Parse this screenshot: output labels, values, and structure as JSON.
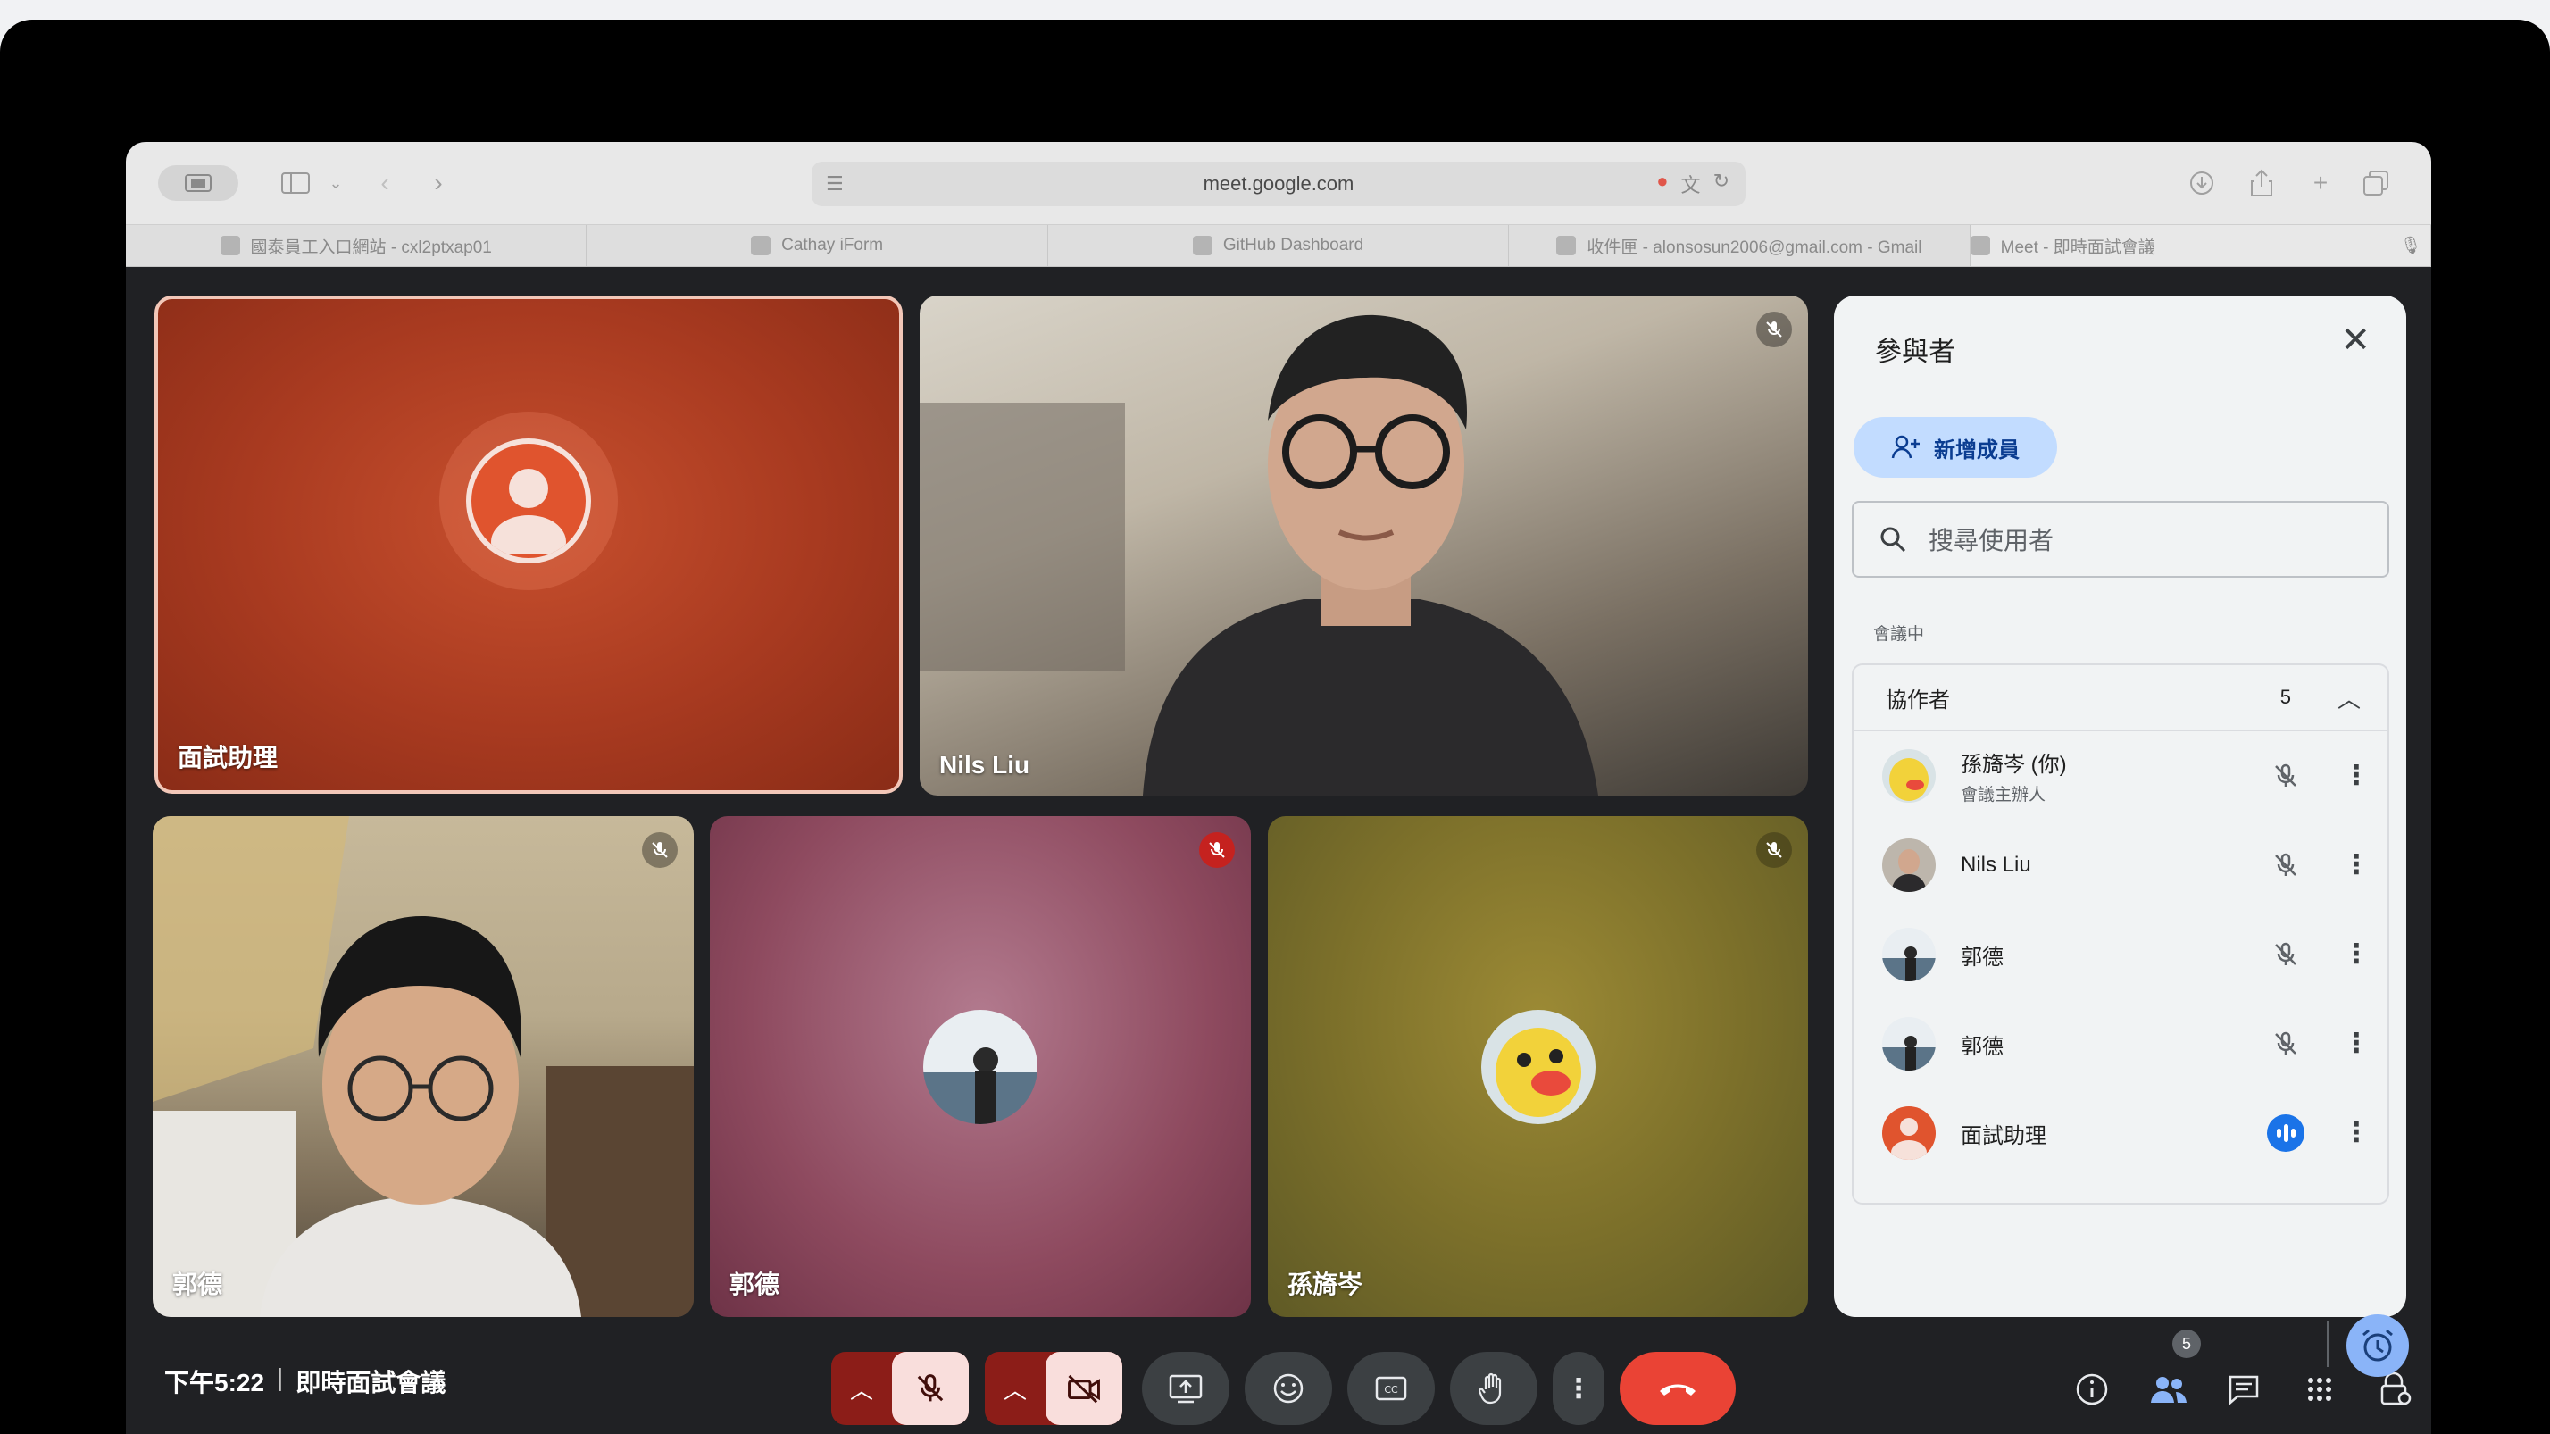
{
  "browser": {
    "url": "meet.google.com",
    "tabs": [
      {
        "label": "國泰員工入口網站 - cxl2ptxap01",
        "active": false
      },
      {
        "label": "Cathay iForm",
        "active": false
      },
      {
        "label": "GitHub Dashboard",
        "active": false
      },
      {
        "label": "收件匣 - alonsosun2006@gmail.com - Gmail",
        "active": false
      },
      {
        "label": "Meet - 即時面試會議",
        "active": true
      }
    ]
  },
  "tiles": [
    {
      "name": "面試助理",
      "muted": false,
      "highlight": true
    },
    {
      "name": "Nils Liu",
      "muted": true
    },
    {
      "name": "郭德",
      "muted": true
    },
    {
      "name": "郭德",
      "muted": true
    },
    {
      "name": "孫旖岑",
      "muted": true
    }
  ],
  "panel": {
    "title": "參與者",
    "add_label": "新增成員",
    "search_placeholder": "搜尋使用者",
    "section_label": "會議中",
    "group_label": "協作者",
    "group_count": "5",
    "participants": [
      {
        "name": "孫旖岑 (你)",
        "role": "會議主辦人",
        "state": "muted"
      },
      {
        "name": "Nils Liu",
        "role": "",
        "state": "muted"
      },
      {
        "name": "郭德",
        "role": "",
        "state": "muted"
      },
      {
        "name": "郭德",
        "role": "",
        "state": "muted"
      },
      {
        "name": "面試助理",
        "role": "",
        "state": "speaking"
      }
    ]
  },
  "bottom_bar": {
    "time": "下午5:22",
    "separator": "|",
    "meeting_title": "即時面試會議",
    "people_count": "5"
  },
  "colors": {
    "end_call": "#ea4335",
    "mic_off_bg": "#f9dedc",
    "add_member_bg": "#c2dcff",
    "speaking": "#1a73e8"
  }
}
